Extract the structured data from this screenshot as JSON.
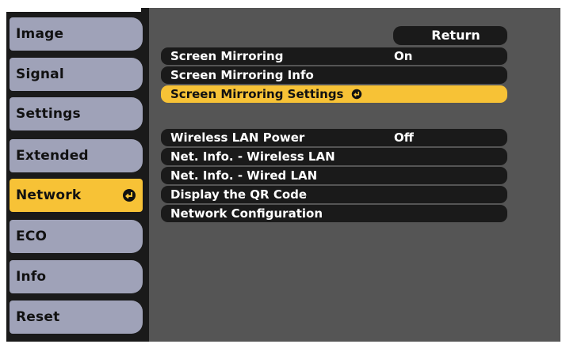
{
  "tabs": [
    {
      "label": "Image",
      "active": false
    },
    {
      "label": "Signal",
      "active": false
    },
    {
      "label": "Settings",
      "active": false
    },
    {
      "label": "Extended",
      "active": false
    },
    {
      "label": "Network",
      "active": true
    },
    {
      "label": "ECO",
      "active": false
    },
    {
      "label": "Info",
      "active": false
    },
    {
      "label": "Reset",
      "active": false
    }
  ],
  "return_label": "Return",
  "menu": {
    "screen_mirroring": {
      "label": "Screen Mirroring",
      "value": "On"
    },
    "screen_mirroring_info": {
      "label": "Screen Mirroring Info"
    },
    "screen_mirroring_settings": {
      "label": "Screen Mirroring Settings"
    },
    "wireless_lan_power": {
      "label": "Wireless LAN Power",
      "value": "Off"
    },
    "net_info_wireless": {
      "label": "Net. Info. - Wireless LAN"
    },
    "net_info_wired": {
      "label": "Net. Info. - Wired LAN"
    },
    "display_qr": {
      "label": "Display the QR Code"
    },
    "network_config": {
      "label": "Network Configuration"
    }
  },
  "colors": {
    "highlight": "#f7c236",
    "tab": "#9fa2b8",
    "panel": "#555555",
    "row": "#1a1a1a"
  },
  "icons": {
    "enter": "enter-icon"
  }
}
